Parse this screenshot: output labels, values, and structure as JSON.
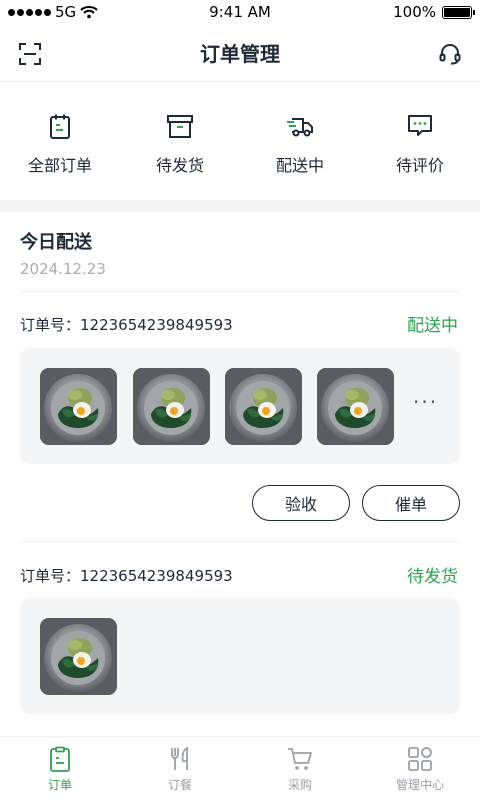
{
  "status_bar": {
    "carrier": "5G",
    "time": "9:41 AM",
    "battery": "100%"
  },
  "nav": {
    "title": "订单管理",
    "left_icon": "scan-icon",
    "right_icon": "headset-icon"
  },
  "tabs": [
    {
      "label": "全部订单",
      "icon": "clipboard-icon"
    },
    {
      "label": "待发货",
      "icon": "package-icon"
    },
    {
      "label": "配送中",
      "icon": "delivery-truck-icon"
    },
    {
      "label": "待评价",
      "icon": "comment-icon"
    }
  ],
  "section": {
    "title": "今日配送",
    "date": "2024.12.23"
  },
  "orders": [
    {
      "order_no": "订单号：1223654239849593",
      "status": "配送中",
      "image_count": 4,
      "more": "···",
      "actions": [
        "验收",
        "催单"
      ]
    },
    {
      "order_no": "订单号：1223654239849593",
      "status": "待发货",
      "image_count": 1
    }
  ],
  "bottom_nav": [
    {
      "label": "订单",
      "icon": "order-clipboard-icon",
      "active": true
    },
    {
      "label": "订餐",
      "icon": "fork-knife-icon",
      "active": false
    },
    {
      "label": "采购",
      "icon": "shopping-cart-icon",
      "active": false
    },
    {
      "label": "管理中心",
      "icon": "grid-icon",
      "active": false
    }
  ],
  "colors": {
    "accent": "#2ea44f",
    "text": "#1f2a37",
    "muted": "#a9adb3",
    "background_gray": "#f4f5f7"
  }
}
